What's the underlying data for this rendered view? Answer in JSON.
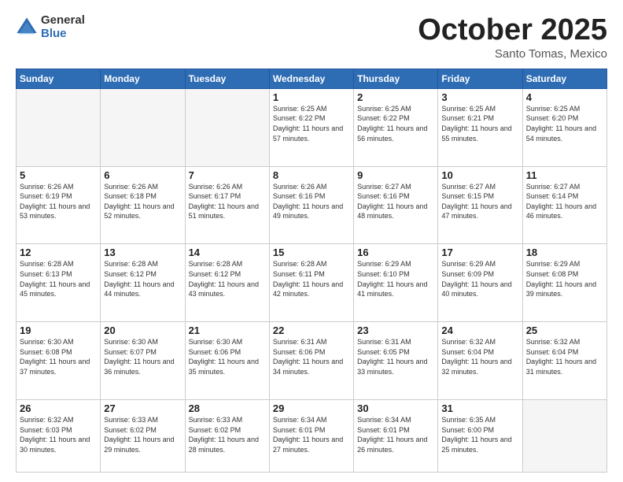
{
  "header": {
    "logo_general": "General",
    "logo_blue": "Blue",
    "month": "October 2025",
    "location": "Santo Tomas, Mexico"
  },
  "days_of_week": [
    "Sunday",
    "Monday",
    "Tuesday",
    "Wednesday",
    "Thursday",
    "Friday",
    "Saturday"
  ],
  "weeks": [
    [
      {
        "day": "",
        "info": ""
      },
      {
        "day": "",
        "info": ""
      },
      {
        "day": "",
        "info": ""
      },
      {
        "day": "1",
        "info": "Sunrise: 6:25 AM\nSunset: 6:22 PM\nDaylight: 11 hours\nand 57 minutes."
      },
      {
        "day": "2",
        "info": "Sunrise: 6:25 AM\nSunset: 6:22 PM\nDaylight: 11 hours\nand 56 minutes."
      },
      {
        "day": "3",
        "info": "Sunrise: 6:25 AM\nSunset: 6:21 PM\nDaylight: 11 hours\nand 55 minutes."
      },
      {
        "day": "4",
        "info": "Sunrise: 6:25 AM\nSunset: 6:20 PM\nDaylight: 11 hours\nand 54 minutes."
      }
    ],
    [
      {
        "day": "5",
        "info": "Sunrise: 6:26 AM\nSunset: 6:19 PM\nDaylight: 11 hours\nand 53 minutes."
      },
      {
        "day": "6",
        "info": "Sunrise: 6:26 AM\nSunset: 6:18 PM\nDaylight: 11 hours\nand 52 minutes."
      },
      {
        "day": "7",
        "info": "Sunrise: 6:26 AM\nSunset: 6:17 PM\nDaylight: 11 hours\nand 51 minutes."
      },
      {
        "day": "8",
        "info": "Sunrise: 6:26 AM\nSunset: 6:16 PM\nDaylight: 11 hours\nand 49 minutes."
      },
      {
        "day": "9",
        "info": "Sunrise: 6:27 AM\nSunset: 6:16 PM\nDaylight: 11 hours\nand 48 minutes."
      },
      {
        "day": "10",
        "info": "Sunrise: 6:27 AM\nSunset: 6:15 PM\nDaylight: 11 hours\nand 47 minutes."
      },
      {
        "day": "11",
        "info": "Sunrise: 6:27 AM\nSunset: 6:14 PM\nDaylight: 11 hours\nand 46 minutes."
      }
    ],
    [
      {
        "day": "12",
        "info": "Sunrise: 6:28 AM\nSunset: 6:13 PM\nDaylight: 11 hours\nand 45 minutes."
      },
      {
        "day": "13",
        "info": "Sunrise: 6:28 AM\nSunset: 6:12 PM\nDaylight: 11 hours\nand 44 minutes."
      },
      {
        "day": "14",
        "info": "Sunrise: 6:28 AM\nSunset: 6:12 PM\nDaylight: 11 hours\nand 43 minutes."
      },
      {
        "day": "15",
        "info": "Sunrise: 6:28 AM\nSunset: 6:11 PM\nDaylight: 11 hours\nand 42 minutes."
      },
      {
        "day": "16",
        "info": "Sunrise: 6:29 AM\nSunset: 6:10 PM\nDaylight: 11 hours\nand 41 minutes."
      },
      {
        "day": "17",
        "info": "Sunrise: 6:29 AM\nSunset: 6:09 PM\nDaylight: 11 hours\nand 40 minutes."
      },
      {
        "day": "18",
        "info": "Sunrise: 6:29 AM\nSunset: 6:08 PM\nDaylight: 11 hours\nand 39 minutes."
      }
    ],
    [
      {
        "day": "19",
        "info": "Sunrise: 6:30 AM\nSunset: 6:08 PM\nDaylight: 11 hours\nand 37 minutes."
      },
      {
        "day": "20",
        "info": "Sunrise: 6:30 AM\nSunset: 6:07 PM\nDaylight: 11 hours\nand 36 minutes."
      },
      {
        "day": "21",
        "info": "Sunrise: 6:30 AM\nSunset: 6:06 PM\nDaylight: 11 hours\nand 35 minutes."
      },
      {
        "day": "22",
        "info": "Sunrise: 6:31 AM\nSunset: 6:06 PM\nDaylight: 11 hours\nand 34 minutes."
      },
      {
        "day": "23",
        "info": "Sunrise: 6:31 AM\nSunset: 6:05 PM\nDaylight: 11 hours\nand 33 minutes."
      },
      {
        "day": "24",
        "info": "Sunrise: 6:32 AM\nSunset: 6:04 PM\nDaylight: 11 hours\nand 32 minutes."
      },
      {
        "day": "25",
        "info": "Sunrise: 6:32 AM\nSunset: 6:04 PM\nDaylight: 11 hours\nand 31 minutes."
      }
    ],
    [
      {
        "day": "26",
        "info": "Sunrise: 6:32 AM\nSunset: 6:03 PM\nDaylight: 11 hours\nand 30 minutes."
      },
      {
        "day": "27",
        "info": "Sunrise: 6:33 AM\nSunset: 6:02 PM\nDaylight: 11 hours\nand 29 minutes."
      },
      {
        "day": "28",
        "info": "Sunrise: 6:33 AM\nSunset: 6:02 PM\nDaylight: 11 hours\nand 28 minutes."
      },
      {
        "day": "29",
        "info": "Sunrise: 6:34 AM\nSunset: 6:01 PM\nDaylight: 11 hours\nand 27 minutes."
      },
      {
        "day": "30",
        "info": "Sunrise: 6:34 AM\nSunset: 6:01 PM\nDaylight: 11 hours\nand 26 minutes."
      },
      {
        "day": "31",
        "info": "Sunrise: 6:35 AM\nSunset: 6:00 PM\nDaylight: 11 hours\nand 25 minutes."
      },
      {
        "day": "",
        "info": ""
      }
    ]
  ]
}
